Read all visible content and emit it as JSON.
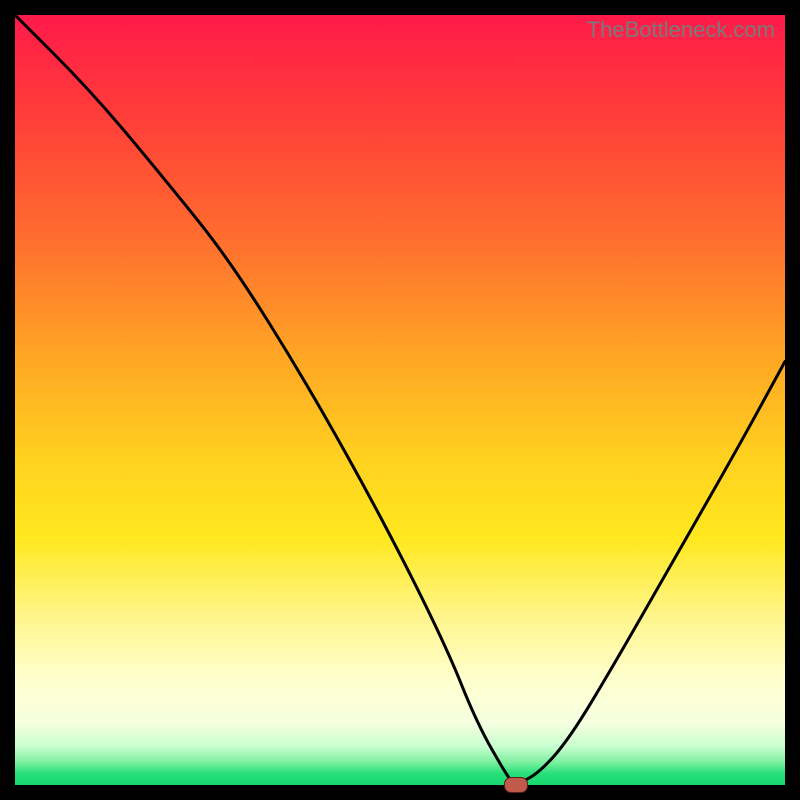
{
  "watermark": "TheBottleneck.com",
  "chart_data": {
    "type": "line",
    "title": "",
    "xlabel": "",
    "ylabel": "",
    "xlim": [
      0,
      100
    ],
    "ylim": [
      0,
      100
    ],
    "series": [
      {
        "name": "bottleneck-curve",
        "x": [
          0,
          10,
          20,
          28,
          38,
          48,
          56,
          60,
          64,
          65,
          68,
          72,
          78,
          86,
          94,
          100
        ],
        "y": [
          100,
          90,
          78,
          68,
          52,
          34,
          18,
          8,
          1,
          0,
          1.5,
          6,
          16,
          30,
          44,
          55
        ]
      }
    ],
    "marker": {
      "x": 65,
      "y": 0,
      "color": "#c1594c"
    },
    "background_gradient": {
      "top": "#ff1a4a",
      "bottom": "#18d86e"
    }
  }
}
